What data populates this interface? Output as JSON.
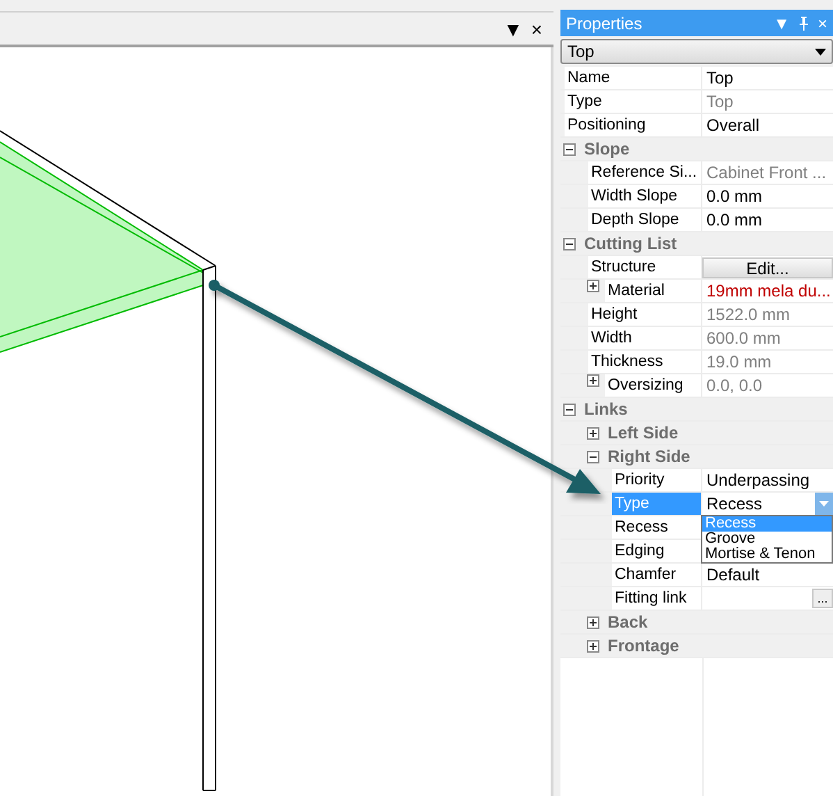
{
  "viewport": {
    "header_buttons": [
      "▼",
      "×"
    ]
  },
  "properties": {
    "title": "Properties",
    "title_buttons": [
      "▼",
      "×"
    ],
    "object_combo": "Top",
    "rows": [
      {
        "kind": "property",
        "label": "Name",
        "value": "Top",
        "disabled": false,
        "invalid": false,
        "selected": false
      },
      {
        "kind": "property",
        "label": "Type",
        "value": "Top",
        "disabled": true,
        "invalid": false,
        "selected": false
      },
      {
        "kind": "property",
        "label": "Positioning",
        "value": "Overall",
        "disabled": false,
        "invalid": false,
        "selected": false
      },
      {
        "kind": "group",
        "label": "Slope",
        "expanded": true,
        "selected": false,
        "children": [
          {
            "kind": "property",
            "label": "Reference Si...",
            "value": "Cabinet Front ...",
            "disabled": true,
            "invalid": false,
            "selected": false
          },
          {
            "kind": "property",
            "label": "Width Slope",
            "value": "0.0 mm",
            "disabled": false,
            "invalid": false,
            "selected": false
          },
          {
            "kind": "property",
            "label": "Depth Slope",
            "value": "0.0 mm",
            "disabled": false,
            "invalid": false,
            "selected": false
          }
        ]
      },
      {
        "kind": "group",
        "label": "Cutting List",
        "expanded": true,
        "selected": false,
        "children": [
          {
            "kind": "button",
            "label": "Structure",
            "value": "Edit...",
            "selected": false
          },
          {
            "kind": "property",
            "label": "Material",
            "value": "19mm mela du...",
            "disabled": false,
            "invalid": true,
            "expanded": false,
            "selected": false
          },
          {
            "kind": "property",
            "label": "Height",
            "value": "1522.0 mm",
            "disabled": true,
            "invalid": false,
            "selected": false
          },
          {
            "kind": "property",
            "label": "Width",
            "value": "600.0 mm",
            "disabled": true,
            "invalid": false,
            "selected": false
          },
          {
            "kind": "property",
            "label": "Thickness",
            "value": "19.0 mm",
            "disabled": true,
            "invalid": false,
            "selected": false
          },
          {
            "kind": "property",
            "label": "Oversizing",
            "value": "0.0, 0.0",
            "disabled": true,
            "invalid": false,
            "expanded": false,
            "selected": false
          }
        ]
      },
      {
        "kind": "group",
        "label": "Links",
        "expanded": true,
        "selected": false,
        "children": [
          {
            "kind": "group",
            "label": "Left Side",
            "expanded": false,
            "selected": false
          },
          {
            "kind": "group",
            "label": "Right Side",
            "expanded": true,
            "selected": false,
            "children": [
              {
                "kind": "property",
                "label": "Priority",
                "value": "Underpassing",
                "disabled": false,
                "invalid": false,
                "selected": false
              },
              {
                "kind": "combo",
                "label": "Type",
                "value": "Recess",
                "selected": true,
                "options": [
                  {
                    "label": "Recess",
                    "selected": true
                  },
                  {
                    "label": "Groove",
                    "selected": false
                  },
                  {
                    "label": "Mortise & Tenon",
                    "selected": false
                  }
                ]
              },
              {
                "kind": "property",
                "label": "Recess",
                "selected": false
              },
              {
                "kind": "property",
                "label": "Edging",
                "selected": false
              },
              {
                "kind": "property",
                "label": "Chamfer",
                "value": "Default",
                "disabled": false,
                "invalid": false,
                "selected": false
              },
              {
                "kind": "ellipsis",
                "label": "Fitting link",
                "button": "...",
                "selected": false
              }
            ]
          },
          {
            "kind": "group",
            "label": "Back",
            "expanded": false,
            "selected": false
          },
          {
            "kind": "group",
            "label": "Frontage",
            "expanded": false,
            "selected": false
          }
        ]
      }
    ]
  }
}
